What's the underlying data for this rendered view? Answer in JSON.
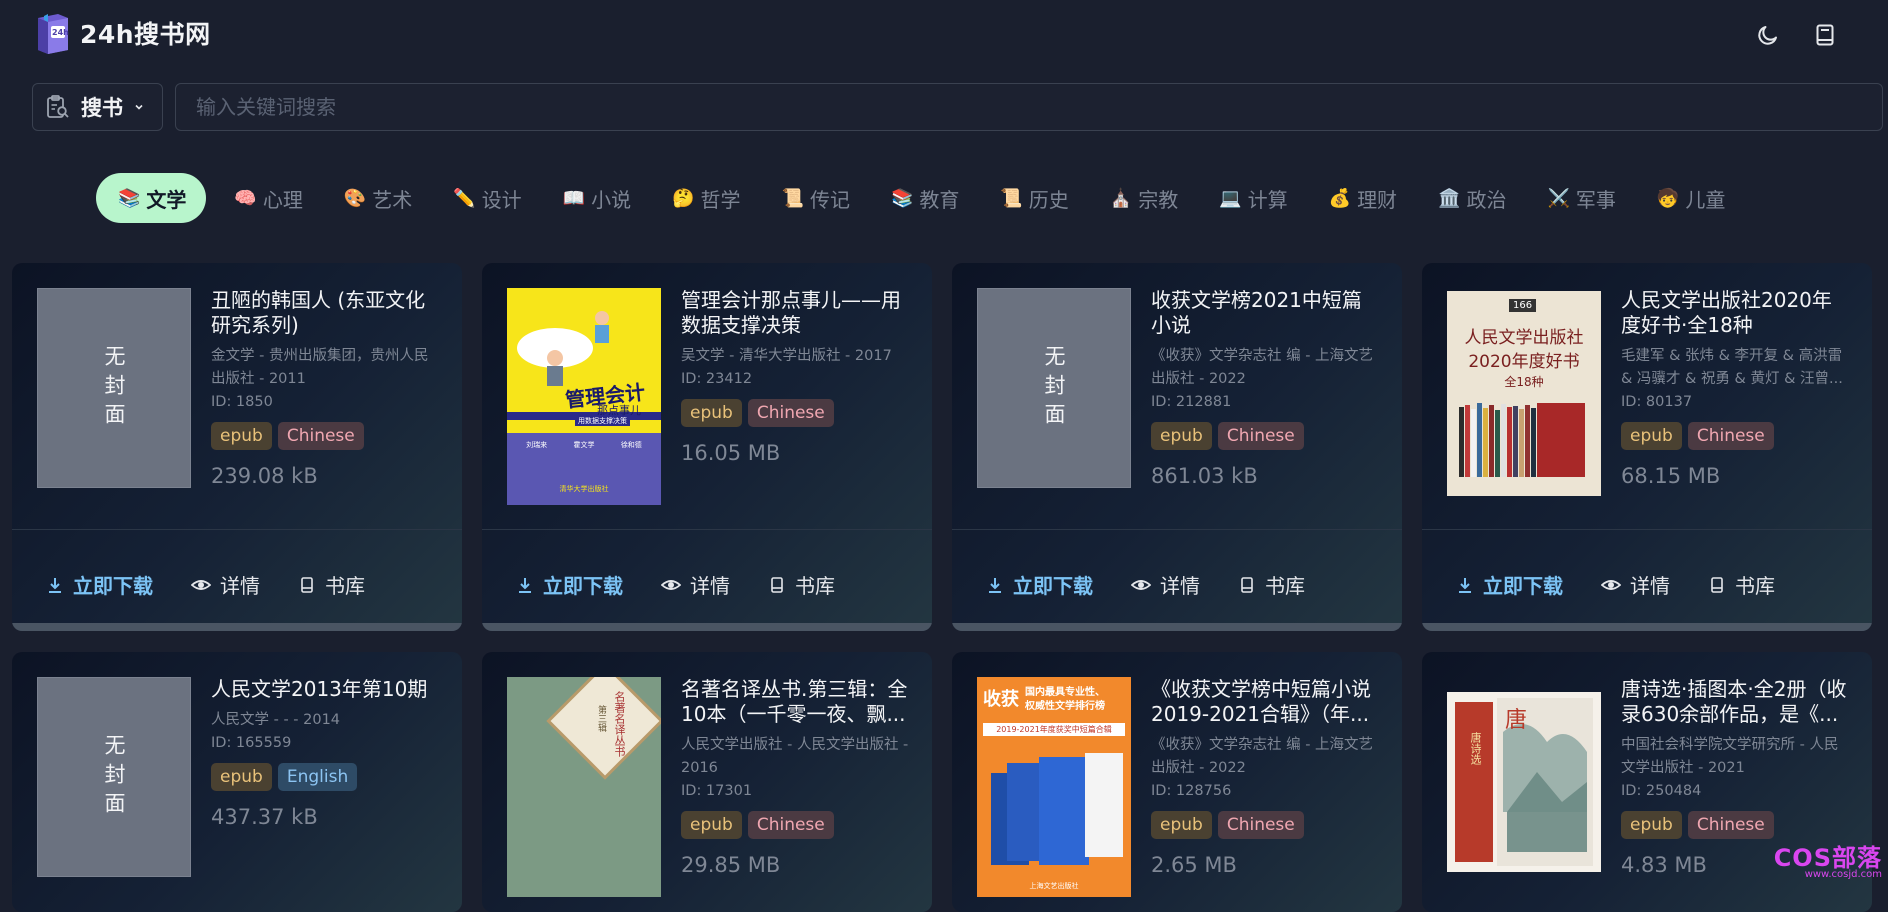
{
  "header": {
    "logo_text": "24h搜书网",
    "logo_badge": "24h",
    "theme_icon": "moon-icon",
    "library_icon": "book-icon"
  },
  "search": {
    "mode_label": "搜书",
    "placeholder": "输入关键词搜索",
    "value": ""
  },
  "categories": [
    {
      "emoji": "📚",
      "label": "文学",
      "active": true
    },
    {
      "emoji": "🧠",
      "label": "心理"
    },
    {
      "emoji": "🎨",
      "label": "艺术"
    },
    {
      "emoji": "✏️",
      "label": "设计"
    },
    {
      "emoji": "📖",
      "label": "小说"
    },
    {
      "emoji": "🤔",
      "label": "哲学"
    },
    {
      "emoji": "📜",
      "label": "传记"
    },
    {
      "emoji": "📚",
      "label": "教育"
    },
    {
      "emoji": "📜",
      "label": "历史"
    },
    {
      "emoji": "⛪",
      "label": "宗教"
    },
    {
      "emoji": "💻",
      "label": "计算"
    },
    {
      "emoji": "💰",
      "label": "理财"
    },
    {
      "emoji": "🏛️",
      "label": "政治"
    },
    {
      "emoji": "⚔️",
      "label": "军事"
    },
    {
      "emoji": "🧒",
      "label": "儿童"
    }
  ],
  "no_cover_text": "无封面",
  "actions": {
    "download": "立即下载",
    "details": "详情",
    "library": "书库"
  },
  "books": [
    {
      "title": "丑陋的韩国人 (东亚文化研究系列)",
      "meta": "金文学 - 贵州出版集团，贵州人民出版社 - 2011",
      "id": "ID: 1850",
      "format": "epub",
      "language": "Chinese",
      "size": "239.08 kB",
      "cover": "none"
    },
    {
      "title": "管理会计那点事儿——用数据支撑决策",
      "meta": "吴文学 - 清华大学出版社 - 2017",
      "id": "ID: 23412",
      "format": "epub",
      "language": "Chinese",
      "size": "16.05 MB",
      "cover": "yellow",
      "cover_text": {
        "main": "管理会计",
        "sub": "那点事儿",
        "tag": "用数据支撑决策",
        "authors": [
          "刘瑞来",
          "霍文学",
          "徐和德"
        ],
        "press": "清华大学出版社"
      }
    },
    {
      "title": "收获文学榜2021中短篇小说",
      "meta": "《收获》文学杂志社 编 - 上海文艺出版社 - 2022",
      "id": "ID: 212881",
      "format": "epub",
      "language": "Chinese",
      "size": "861.03 kB",
      "cover": "none"
    },
    {
      "title": "人民文学出版社2020年度好书·全18种",
      "meta": "毛建军 & 张炜 & 李开复 & 高洪雷 & 冯骥才 & 祝勇 & 黄灯 & 汪曾...",
      "id": "ID: 80137",
      "format": "epub",
      "language": "Chinese",
      "size": "68.15 MB",
      "cover": "beige",
      "cover_text": {
        "badge": "166",
        "line1": "人民文学出版社",
        "line2": "2020年度好书",
        "line3": "全18种"
      }
    },
    {
      "title": "人民文学2013年第10期",
      "meta": "人民文学 - - - 2014",
      "id": "ID: 165559",
      "format": "epub",
      "language": "English",
      "size": "437.37 kB",
      "cover": "none"
    },
    {
      "title": "名著名译丛书.第三辑：全10本（一千零一夜、飘...",
      "meta": "人民文学出版社 - 人民文学出版社 - 2016",
      "id": "ID: 17301",
      "format": "epub",
      "language": "Chinese",
      "size": "29.85 MB",
      "cover": "green",
      "cover_text": {
        "main": "名著名译丛书",
        "sub": "第三辑"
      }
    },
    {
      "title": "《收获文学榜中短篇小说2019-2021合辑》（年...",
      "meta": "《收获》文学杂志社 编 - 上海文艺出版社 - 2022",
      "id": "ID: 128756",
      "format": "epub",
      "language": "Chinese",
      "size": "2.65 MB",
      "cover": "orange",
      "cover_text": {
        "brand": "收获",
        "line1": "国内最具专业性、",
        "line2": "权威性文学排行榜",
        "banner": "2019-2021年度获奖中短篇合辑",
        "press": "上海文艺出版社"
      }
    },
    {
      "title": "唐诗选·插图本·全2册（收录630余部作品，是《...",
      "meta": "中国社会科学院文学研究所 - 人民文学出版社 - 2021",
      "id": "ID: 250484",
      "format": "epub",
      "language": "Chinese",
      "size": "4.83 MB",
      "cover": "painting",
      "cover_text": {
        "spine": "唐诗选",
        "brand": "唐"
      }
    }
  ],
  "watermark": {
    "main": "COS部落",
    "sub": "www.cosjd.com"
  }
}
